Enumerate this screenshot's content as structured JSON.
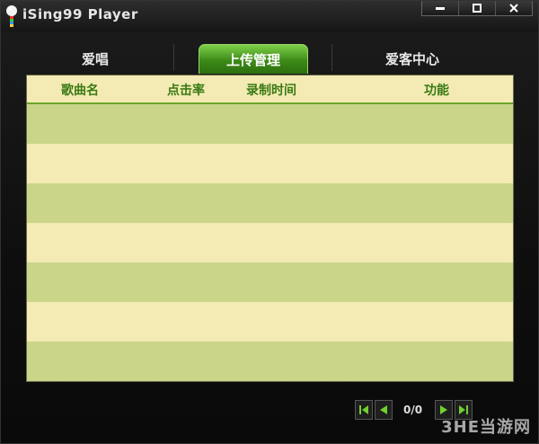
{
  "app": {
    "title": "iSing99 Player"
  },
  "tabs": [
    {
      "label": "爱唱"
    },
    {
      "label": "上传管理"
    },
    {
      "label": "爱客中心"
    }
  ],
  "table": {
    "columns": [
      "歌曲名",
      "点击率",
      "录制时间",
      "功能"
    ]
  },
  "pager": {
    "info": "0/0"
  },
  "watermark": {
    "text": "3HE当游网"
  },
  "colors": {
    "accent_green": "#3c8a17",
    "row_light": "#f3ebb3",
    "row_dark": "#cbd58a",
    "header_text": "#3a7a14"
  }
}
